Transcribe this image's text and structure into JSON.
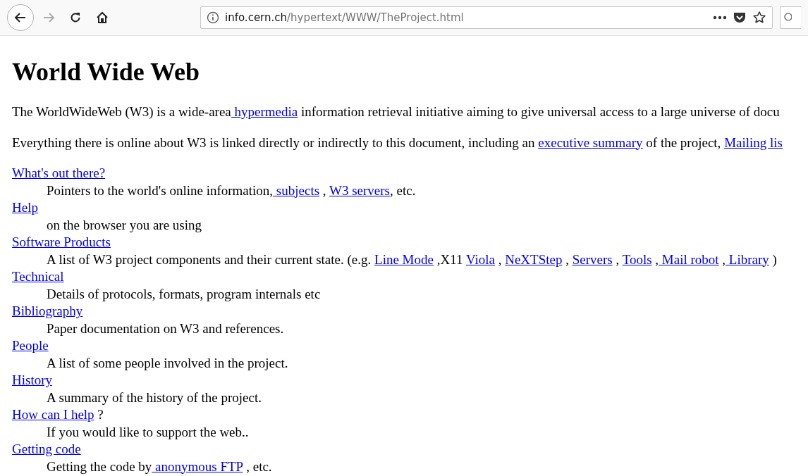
{
  "toolbar": {
    "back_enabled": true,
    "forward_enabled": false,
    "address": {
      "host": "info.cern.ch",
      "path": "/hypertext/WWW/TheProject.html"
    }
  },
  "page": {
    "title": "World Wide Web",
    "paragraphs": [
      [
        {
          "kind": "text",
          "text": "The WorldWideWeb (W3) is a wide-area"
        },
        {
          "kind": "link",
          "text": " hypermedia"
        },
        {
          "kind": "text",
          "text": " information retrieval initiative aiming to give universal access to a large universe of docu"
        }
      ],
      [
        {
          "kind": "text",
          "text": "Everything there is online about W3 is linked directly or indirectly to this document, including an "
        },
        {
          "kind": "link",
          "text": "executive summary"
        },
        {
          "kind": "text",
          "text": " of the project, "
        },
        {
          "kind": "link",
          "text": "Mailing lis"
        }
      ]
    ],
    "entries": [
      {
        "term": [
          {
            "kind": "link",
            "text": "What's out there?"
          }
        ],
        "description": [
          {
            "kind": "text",
            "text": "Pointers to the world's online information,"
          },
          {
            "kind": "link",
            "text": " subjects"
          },
          {
            "kind": "text",
            "text": " , "
          },
          {
            "kind": "link",
            "text": "W3 servers"
          },
          {
            "kind": "text",
            "text": ", etc."
          }
        ]
      },
      {
        "term": [
          {
            "kind": "link",
            "text": "Help"
          }
        ],
        "description": [
          {
            "kind": "text",
            "text": "on the browser you are using"
          }
        ]
      },
      {
        "term": [
          {
            "kind": "link",
            "text": "Software Products"
          }
        ],
        "description": [
          {
            "kind": "text",
            "text": "A list of W3 project components and their current state. (e.g. "
          },
          {
            "kind": "link",
            "text": "Line Mode"
          },
          {
            "kind": "text",
            "text": " ,X11 "
          },
          {
            "kind": "link",
            "text": "Viola"
          },
          {
            "kind": "text",
            "text": " , "
          },
          {
            "kind": "link",
            "text": "NeXTStep"
          },
          {
            "kind": "text",
            "text": " , "
          },
          {
            "kind": "link",
            "text": "Servers"
          },
          {
            "kind": "text",
            "text": " , "
          },
          {
            "kind": "link",
            "text": "Tools"
          },
          {
            "kind": "text",
            "text": " ,"
          },
          {
            "kind": "link",
            "text": " Mail robot"
          },
          {
            "kind": "text",
            "text": " ,"
          },
          {
            "kind": "link",
            "text": " Library"
          },
          {
            "kind": "text",
            "text": " )"
          }
        ]
      },
      {
        "term": [
          {
            "kind": "link",
            "text": "Technical"
          }
        ],
        "description": [
          {
            "kind": "text",
            "text": "Details of protocols, formats, program internals etc"
          }
        ]
      },
      {
        "term": [
          {
            "kind": "link",
            "text": "Bibliography"
          }
        ],
        "description": [
          {
            "kind": "text",
            "text": "Paper documentation on W3 and references."
          }
        ]
      },
      {
        "term": [
          {
            "kind": "link",
            "text": "People"
          }
        ],
        "description": [
          {
            "kind": "text",
            "text": "A list of some people involved in the project."
          }
        ]
      },
      {
        "term": [
          {
            "kind": "link",
            "text": "History"
          }
        ],
        "description": [
          {
            "kind": "text",
            "text": "A summary of the history of the project."
          }
        ]
      },
      {
        "term": [
          {
            "kind": "link",
            "text": "How can I help"
          },
          {
            "kind": "text",
            "text": " ?"
          }
        ],
        "description": [
          {
            "kind": "text",
            "text": "If you would like to support the web.."
          }
        ]
      },
      {
        "term": [
          {
            "kind": "link",
            "text": "Getting code"
          }
        ],
        "description": [
          {
            "kind": "text",
            "text": "Getting the code by"
          },
          {
            "kind": "link",
            "text": " anonymous FTP"
          },
          {
            "kind": "text",
            "text": " , etc."
          }
        ]
      }
    ]
  }
}
